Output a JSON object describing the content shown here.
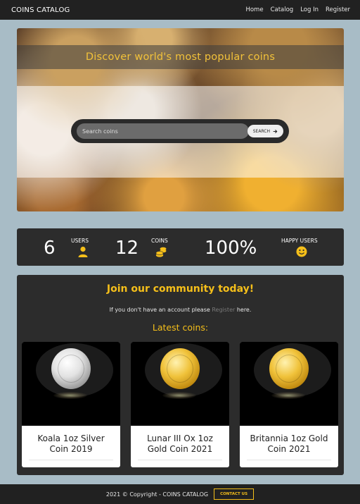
{
  "navbar": {
    "brand": "COINS CATALOG",
    "links": [
      "Home",
      "Catalog",
      "Log In",
      "Register"
    ]
  },
  "hero": {
    "title": "Discover world's most popular coins",
    "search_placeholder": "Search coins",
    "search_button": "SEARCH"
  },
  "stats": {
    "users": {
      "value": "6",
      "label": "USERS",
      "icon": "user-icon"
    },
    "coins": {
      "value": "12",
      "label": "COINS",
      "icon": "coins-icon"
    },
    "happy": {
      "value": "100%",
      "label": "HAPPY USERS",
      "icon": "smile-icon"
    }
  },
  "community": {
    "title": "Join our community today!",
    "text_before": "If you don't have an account please",
    "register_link": "Register",
    "text_after": "here.",
    "latest_title": "Latest coins:"
  },
  "coins": [
    {
      "name": "Koala 1oz Silver Coin 2019",
      "line1": "Koala 1oz Silver",
      "line2": "Coin 2019",
      "metal": "silver"
    },
    {
      "name": "Lunar III Ox 1oz Gold Coin 2021",
      "line1": "Lunar III Ox 1oz",
      "line2": "Gold Coin 2021",
      "metal": "gold"
    },
    {
      "name": "Britannia 1oz Gold Coin 2021",
      "line1": "Britannia 1oz Gold",
      "line2": "Coin 2021",
      "metal": "gold"
    }
  ],
  "footer": {
    "text": "2021 © Copyright -  COINS CATALOG",
    "contact_button": "CONTACT US"
  },
  "colors": {
    "accent": "#f5bf1a",
    "navbar": "#212121",
    "panel": "#2c2c2c",
    "page_bg": "#a8bcc6"
  }
}
